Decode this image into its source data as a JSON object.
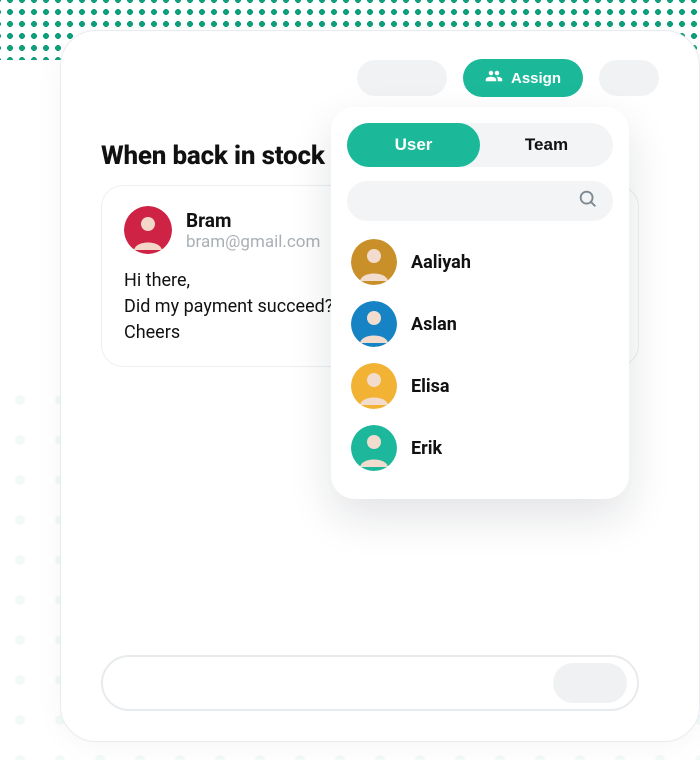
{
  "toolbar": {
    "assign_label": "Assign"
  },
  "subject": "When back in stock",
  "message": {
    "sender_name": "Bram",
    "sender_email": "bram@gmail.com",
    "body": "Hi there,\nDid my payment succeed?\nCheers",
    "avatar_bg": "#cf2345"
  },
  "dropdown": {
    "tabs": {
      "user": "User",
      "team": "Team"
    },
    "active_tab": "user",
    "search_placeholder": "",
    "users": [
      {
        "name": "Aaliyah",
        "avatar_bg": "#c9902a"
      },
      {
        "name": "Aslan",
        "avatar_bg": "#1684c4"
      },
      {
        "name": "Elisa",
        "avatar_bg": "#f2b233"
      },
      {
        "name": "Erik",
        "avatar_bg": "#1db89b"
      }
    ]
  }
}
